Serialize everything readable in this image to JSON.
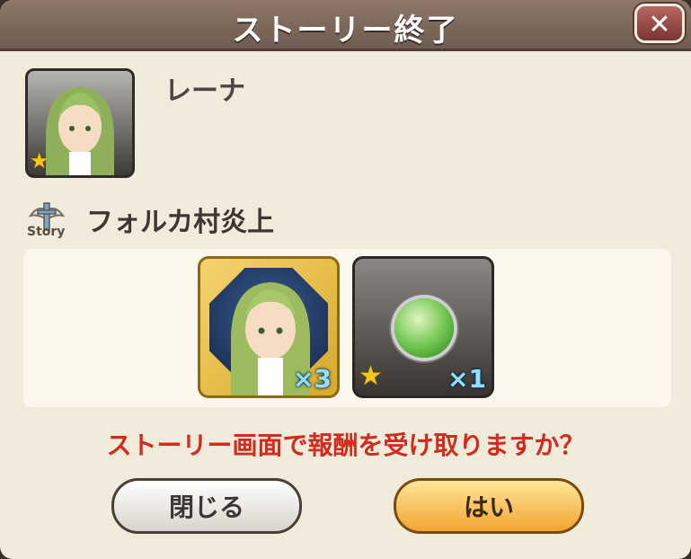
{
  "dialog": {
    "title": "ストーリー終了",
    "close_icon": "close-icon"
  },
  "character": {
    "name": "レーナ",
    "rarity_icon": "star-icon"
  },
  "story": {
    "badge_label": "Story",
    "chapter_title": "フォルカ村炎上"
  },
  "rewards": [
    {
      "type": "character-shard",
      "quantity": "×3"
    },
    {
      "type": "green-orb",
      "rarity_icon": "star-icon",
      "quantity": "×1"
    }
  ],
  "prompt": "ストーリー画面で報酬を受け取りますか？",
  "buttons": {
    "close_label": "閉じる",
    "yes_label": "はい"
  },
  "colors": {
    "accent_red": "#d02c1f",
    "confirm_button": "#f2a531",
    "title_bar": "#7a6659"
  }
}
